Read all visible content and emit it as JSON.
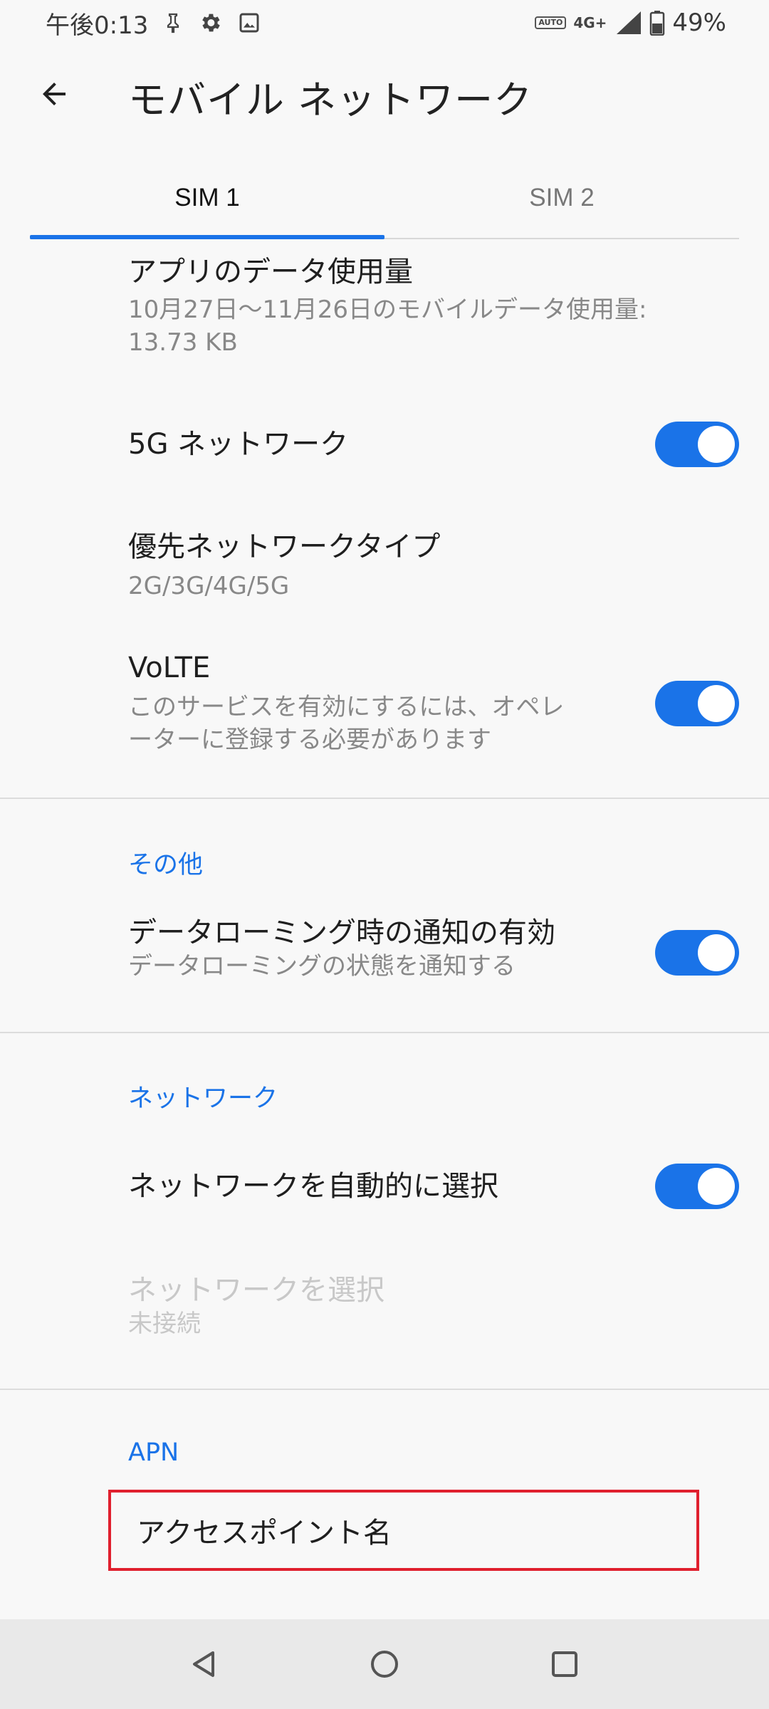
{
  "status_bar": {
    "time": "午後0:13",
    "auto_badge": "AUTO",
    "network_type": "4G+",
    "battery_percent": "49%"
  },
  "app_bar": {
    "title": "モバイル ネットワーク"
  },
  "tabs": [
    {
      "label": "SIM 1",
      "active": true
    },
    {
      "label": "SIM 2",
      "active": false
    }
  ],
  "items": {
    "app_data_usage": {
      "title": "アプリのデータ使用量",
      "subtitle_line1": "10月27日～11月26日のモバイルデータ使用量:",
      "subtitle_line2": "13.73 KB"
    },
    "network_5g": {
      "title": "5G ネットワーク",
      "enabled": true
    },
    "preferred_network": {
      "title": "優先ネットワークタイプ",
      "subtitle": "2G/3G/4G/5G"
    },
    "volte": {
      "title": "VoLTE",
      "subtitle_line1": "このサービスを有効にするには、オペレ",
      "subtitle_line2": "ーターに登録する必要があります",
      "enabled": true
    }
  },
  "sections": {
    "other": {
      "header": "その他",
      "roaming_notify": {
        "title": "データローミング時の通知の有効",
        "subtitle": "データローミングの状態を通知する",
        "enabled": true
      }
    },
    "network": {
      "header": "ネットワーク",
      "auto_select": {
        "title": "ネットワークを自動的に選択",
        "enabled": true
      },
      "select_network": {
        "title": "ネットワークを選択",
        "subtitle": "未接続"
      }
    },
    "apn": {
      "header": "APN",
      "access_point_name": "アクセスポイント名"
    }
  },
  "colors": {
    "accent": "#1a73e8",
    "highlight_border": "#e0202e"
  }
}
